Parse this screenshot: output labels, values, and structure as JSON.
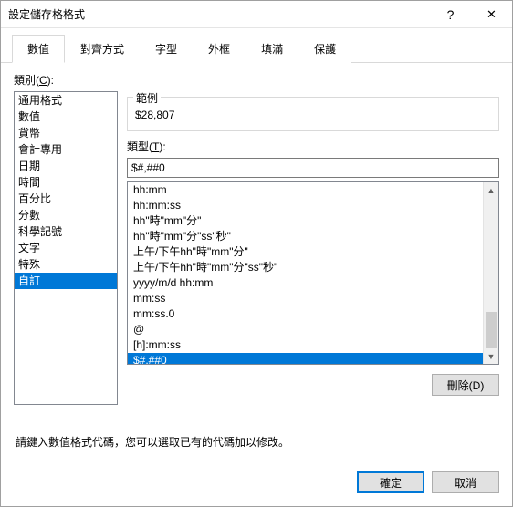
{
  "window": {
    "title": "設定儲存格格式"
  },
  "tabs": [
    "數值",
    "對齊方式",
    "字型",
    "外框",
    "填滿",
    "保護"
  ],
  "activeTab": 0,
  "category": {
    "label_pre": "類別(",
    "label_key": "C",
    "label_post": "):",
    "items": [
      "通用格式",
      "數值",
      "貨幣",
      "會計專用",
      "日期",
      "時間",
      "百分比",
      "分數",
      "科學記號",
      "文字",
      "特殊",
      "自訂"
    ],
    "selectedIndex": 11
  },
  "sample": {
    "caption": "範例",
    "value": "$28,807"
  },
  "type": {
    "label_pre": "類型(",
    "label_key": "T",
    "label_post": "):",
    "input": "$#,##0"
  },
  "formats": [
    "hh:mm",
    "hh:mm:ss",
    "hh\"時\"mm\"分\"",
    "hh\"時\"mm\"分\"ss\"秒\"",
    "上午/下午hh\"時\"mm\"分\"",
    "上午/下午hh\"時\"mm\"分\"ss\"秒\"",
    "yyyy/m/d hh:mm",
    "mm:ss",
    "mm:ss.0",
    "@",
    "[h]:mm:ss",
    "$#,##0"
  ],
  "formatSelectedIndex": 11,
  "delete": {
    "label_pre": "刪除(",
    "label_key": "D",
    "label_post": ")"
  },
  "hint": "請鍵入數值格式代碼，您可以選取已有的代碼加以修改。",
  "buttons": {
    "ok": "確定",
    "cancel": "取消"
  }
}
